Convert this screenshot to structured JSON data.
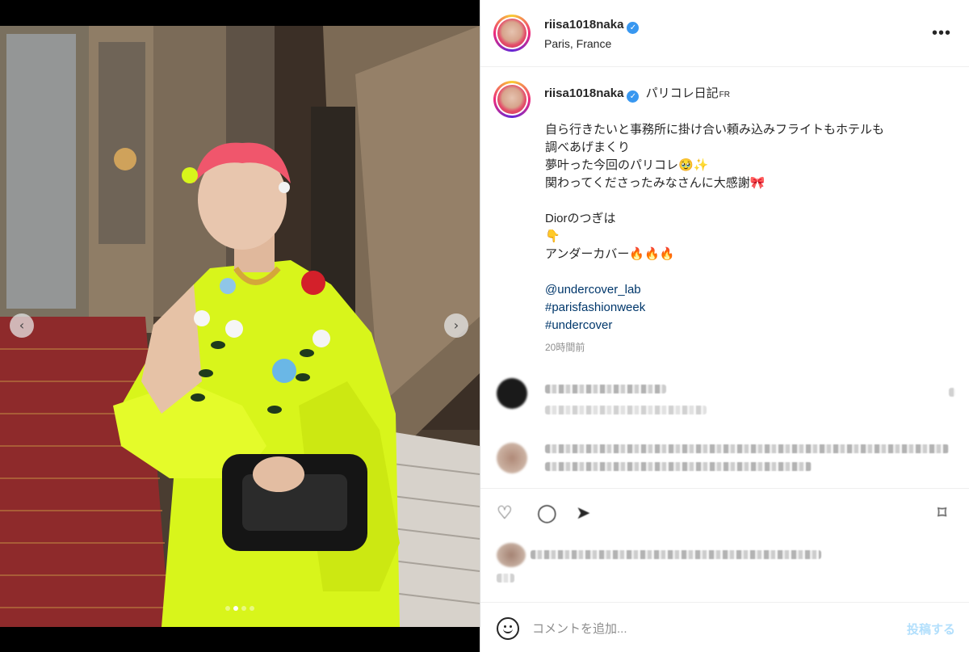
{
  "post": {
    "username": "riisa1018naka",
    "location": "Paris, France",
    "more_icon": "more-options-icon"
  },
  "caption": {
    "username": "riisa1018naka",
    "title": "パリコレ日記",
    "title_suffix": "FR",
    "lines": [
      "自ら行きたいと事務所に掛け合い頼み込みフライトもホテルも",
      "調べあげまくり",
      "夢叶った今回のパリコレ🥹✨",
      "関わってくださったみなさんに大感謝🎀",
      "",
      "Diorのつぎは",
      "👇",
      "アンダーカバー🔥🔥🔥",
      ""
    ],
    "links": [
      "@undercover_lab",
      "#parisfashionweek",
      "#undercover"
    ],
    "time": "20時間前"
  },
  "media": {
    "carousel_total": 4,
    "carousel_active": 1,
    "prev_icon": "chevron-left-icon",
    "next_icon": "chevron-right-icon"
  },
  "composer": {
    "placeholder": "コメントを追加...",
    "post_label": "投稿する"
  },
  "colors": {
    "link": "#00376b",
    "verified": "#3897f0",
    "post_button_disabled": "#b2dffc",
    "secondary_text": "#8e8e8e"
  }
}
